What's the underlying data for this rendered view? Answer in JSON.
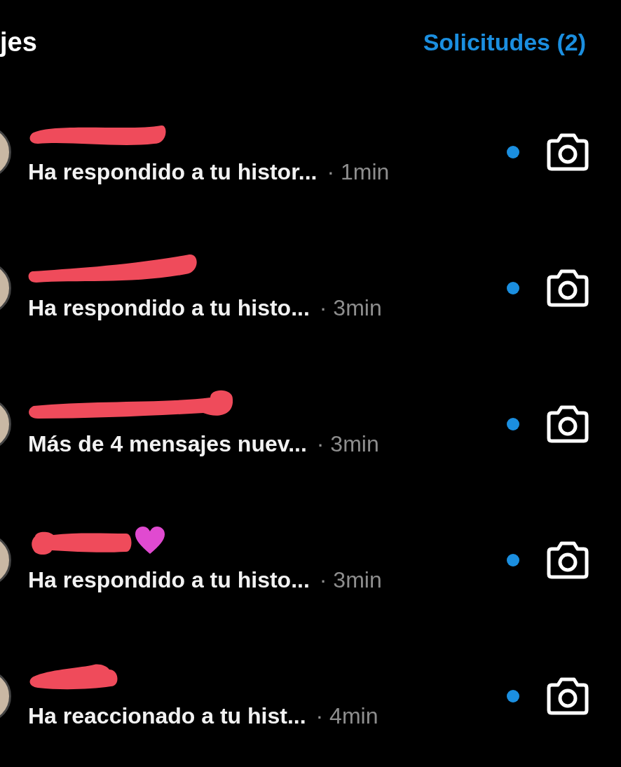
{
  "header": {
    "title": "jes",
    "requests_link": "Solicitudes (2)"
  },
  "threads": [
    {
      "heart": false,
      "message": "Ha respondido a tu histor...",
      "time": "· 1min",
      "unread": true
    },
    {
      "heart": false,
      "message": "Ha respondido a tu histo...",
      "time": "· 3min",
      "unread": true
    },
    {
      "heart": false,
      "message": "Más de 4 mensajes nuev...",
      "time": "· 3min",
      "unread": true
    },
    {
      "heart": true,
      "message": "Ha respondido a tu histo...",
      "time": "· 3min",
      "unread": true
    },
    {
      "heart": false,
      "message": "Ha reaccionado a tu hist...",
      "time": "· 4min",
      "unread": true
    }
  ]
}
